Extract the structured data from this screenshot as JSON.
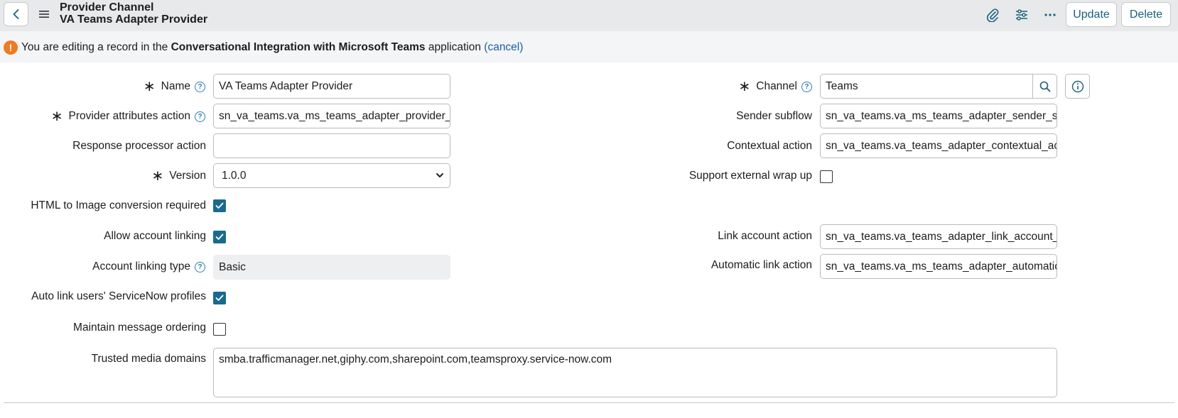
{
  "header": {
    "title_line1": "Provider Channel",
    "title_line2": "VA Teams Adapter Provider",
    "update_label": "Update",
    "delete_label": "Delete"
  },
  "banner": {
    "prefix": "You are editing a record in the",
    "app_name": "Conversational Integration with Microsoft Teams",
    "suffix": "application",
    "cancel_label": "(cancel)"
  },
  "form": {
    "name": {
      "label": "Name",
      "value": "VA Teams Adapter Provider"
    },
    "provider_attributes_action": {
      "label": "Provider attributes action",
      "value": "sn_va_teams.va_ms_teams_adapter_provider_att"
    },
    "response_processor_action": {
      "label": "Response processor action",
      "value": ""
    },
    "version": {
      "label": "Version",
      "value": "1.0.0"
    },
    "html_to_image": {
      "label": "HTML to Image conversion required",
      "checked": true
    },
    "allow_account_linking": {
      "label": "Allow account linking",
      "checked": true
    },
    "account_linking_type": {
      "label": "Account linking type",
      "value": "Basic"
    },
    "auto_link_users": {
      "label": "Auto link users' ServiceNow profiles",
      "checked": true
    },
    "maintain_message_ordering": {
      "label": "Maintain message ordering",
      "checked": false
    },
    "trusted_media_domains": {
      "label": "Trusted media domains",
      "value": "smba.trafficmanager.net,giphy.com,sharepoint.com,teamsproxy.service-now.com"
    },
    "channel": {
      "label": "Channel",
      "value": "Teams"
    },
    "sender_subflow": {
      "label": "Sender subflow",
      "value": "sn_va_teams.va_ms_teams_adapter_sender_subf"
    },
    "contextual_action": {
      "label": "Contextual action",
      "value": "sn_va_teams.va_teams_adapter_contextual_actic"
    },
    "support_external_wrap_up": {
      "label": "Support external wrap up",
      "checked": false
    },
    "link_account_action": {
      "label": "Link account action",
      "value": "sn_va_teams.va_teams_adapter_link_account_ac"
    },
    "automatic_link_action": {
      "label": "Automatic link action",
      "value": "sn_va_teams.va_ms_teams_adapter_automatic_li"
    }
  },
  "icons": {
    "back": "chevron-left-icon",
    "menu": "hamburger-menu-icon",
    "attachment": "paperclip-icon",
    "settings": "sliders-icon",
    "more": "more-horizontal-icon",
    "warning": "exclamation-icon",
    "required": "asterisk-icon",
    "help": "question-circle-icon",
    "search": "search-icon",
    "info": "info-circle-icon",
    "check": "check-icon"
  },
  "colors": {
    "accent": "#1a6a8e",
    "link": "#1a5fa8",
    "warning": "#f07a22",
    "header_bg": "#e8e9ea"
  }
}
